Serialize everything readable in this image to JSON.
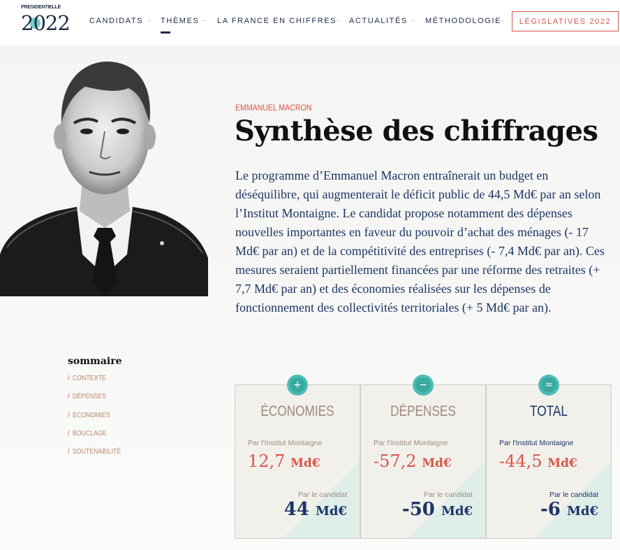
{
  "brand": {
    "logo_top": "PRESIDENTIELLE",
    "logo_year": "2022"
  },
  "nav": {
    "items": [
      "CANDIDATS",
      "THÈMES",
      "LA FRANCE EN CHIFFRES",
      "ACTUALITÉS",
      "MÉTHODOLOGIE"
    ],
    "cta": "LÉGISLATIVES 2022"
  },
  "hero": {
    "kicker": "EMMANUEL MACRON",
    "title": "Synthèse des chiffrages",
    "lead": "Le programme d’Emmanuel Macron entraînerait un budget en déséquilibre, qui augmenterait le déficit public de 44,5 Md€ par an selon l’Institut Montaigne. Le candidat propose notamment des dépenses nouvelles importantes en faveur du pouvoir d’achat des ménages (- 17 Md€ par an) et de la compétitivité des entreprises (- 7,4 Md€ par an). Ces mesures seraient partiellement financées par une réforme des retraites (+ 7,7 Md€ par an) et des économies réalisées sur les dépenses de fonctionnement des collectivités territoriales (+ 5 Md€ par an)."
  },
  "sommaire": {
    "title": "sommaire",
    "items": [
      "CONTEXTE",
      "DÉPENSES",
      "ÉCONOMIES",
      "BOUCLAGE",
      "SOUTENABILITÉ"
    ]
  },
  "cards": [
    {
      "badge": "+",
      "title": "ÉCONOMIES",
      "source1": "Par l'Institut Montaigne",
      "value1": "12,7",
      "unit": "Md€",
      "source2": "Par le candidat",
      "value2": "44"
    },
    {
      "badge": "−",
      "title": "DÉPENSES",
      "source1": "Par l'Institut Montaigne",
      "value1": "-57,2",
      "unit": "Md€",
      "source2": "Par le candidat",
      "value2": "-50"
    },
    {
      "badge": "=",
      "title": "TOTAL",
      "source1": "Par l'Institut Montaigne",
      "value1": "-44,5",
      "unit": "Md€",
      "source2": "Par le candidat",
      "value2": "-6"
    }
  ],
  "colors": {
    "accent": "#d8554a",
    "navy": "#1d3566",
    "teal": "#4dbdb3",
    "muted": "#a08a7c"
  }
}
